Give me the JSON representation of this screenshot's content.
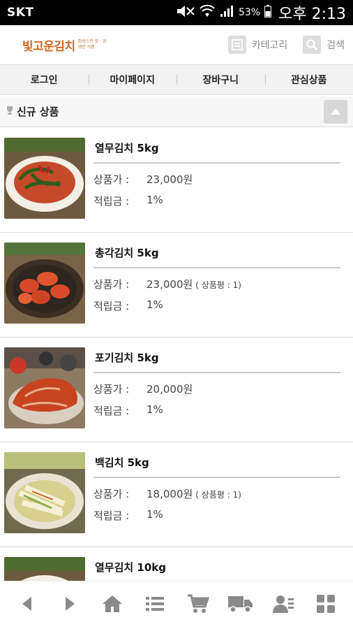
{
  "status_bar": {
    "carrier": "SKT",
    "battery": "53%",
    "time": "오후 2:13"
  },
  "header": {
    "logo_text": "빛고운김치",
    "logo_sub": "정성스런 맛 ·  위생한 식품",
    "category_label": "카테고리",
    "search_label": "검색"
  },
  "nav": {
    "items": [
      {
        "label": "로그인"
      },
      {
        "label": "마이페이지"
      },
      {
        "label": "장바구니"
      },
      {
        "label": "관심상품"
      }
    ]
  },
  "section": {
    "title": "신규 상품"
  },
  "products": [
    {
      "name": "열무김치 5kg",
      "price_label": "상품가 :",
      "price": "23,000원",
      "review": "",
      "points_label": "적립금 :",
      "points": "1%"
    },
    {
      "name": "총각김치 5kg",
      "price_label": "상품가 :",
      "price": "23,000원",
      "review": "( 상품평 : 1)",
      "points_label": "적립금 :",
      "points": "1%"
    },
    {
      "name": "포기김치 5kg",
      "price_label": "상품가 :",
      "price": "20,000원",
      "review": "",
      "points_label": "적립금 :",
      "points": "1%"
    },
    {
      "name": "백김치 5kg",
      "price_label": "상품가 :",
      "price": "18,000원",
      "review": "( 상품평 : 1)",
      "points_label": "적립금 :",
      "points": "1%"
    },
    {
      "name": "열무김치 10kg",
      "price_label": "",
      "price": "",
      "review": "",
      "points_label": "",
      "points": ""
    }
  ],
  "toolbar": {
    "icons": [
      "back-icon",
      "forward-icon",
      "home-icon",
      "menu-list-icon",
      "cart-icon",
      "delivery-truck-icon",
      "my-account-icon",
      "grid-icon"
    ]
  },
  "colors": {
    "logo": "#d2691e",
    "nav_bg": "#f2f2f2",
    "icon_gray": "#8a8a8a"
  }
}
